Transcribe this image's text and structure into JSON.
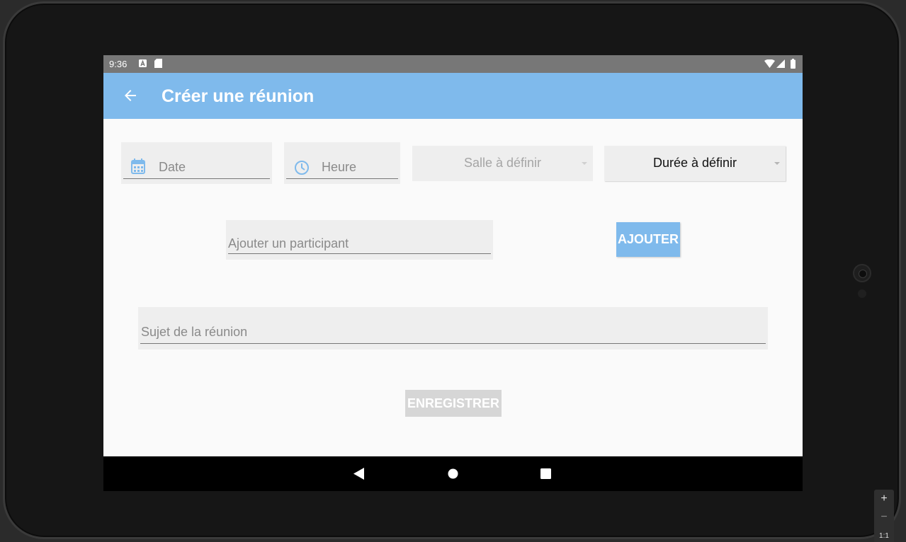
{
  "status_bar": {
    "time": "9:36"
  },
  "app_bar": {
    "title": "Créer une réunion"
  },
  "form": {
    "date_placeholder": "Date",
    "time_placeholder": "Heure",
    "room_spinner": "Salle à définir",
    "duration_spinner": "Durée à définir",
    "participant_placeholder": "Ajouter un participant",
    "add_button": "AJOUTER",
    "subject_placeholder": "Sujet de la réunion",
    "save_button": "ENREGISTRER"
  },
  "zoom_controls": {
    "plus": "+",
    "minus": "−",
    "reset": "1:1"
  },
  "colors": {
    "app_bar": "#7fbaec",
    "accent": "#7fbaec",
    "status_bar": "#777777",
    "disabled_button": "#d6d6d6"
  }
}
